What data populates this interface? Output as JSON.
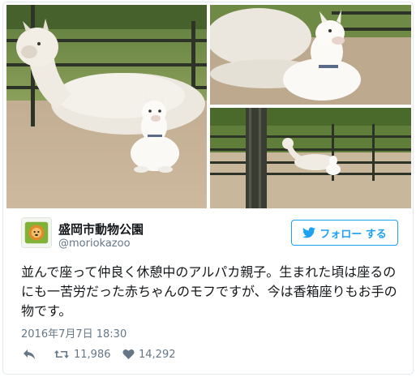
{
  "tweet": {
    "display_name": "盛岡市動物公園",
    "screen_name": "@moriokazoo",
    "follow_label": "フォロー する",
    "text": "並んで座って仲良く休憩中のアルパカ親子。生まれた頃は座るのにも一苦労だった赤ちゃんのモフですが、今は香箱座りもお手の物です。",
    "timestamp": "2016年7月7日 18:30",
    "retweets": "11,986",
    "likes": "14,292"
  },
  "colors": {
    "accent": "#1da1f2",
    "muted": "#657786",
    "border": "#e1e8ed"
  },
  "icons": {
    "follow": "twitter-bird-icon",
    "reply": "reply-icon",
    "retweet": "retweet-icon",
    "like": "heart-icon"
  },
  "media": {
    "photo_count": 3
  }
}
